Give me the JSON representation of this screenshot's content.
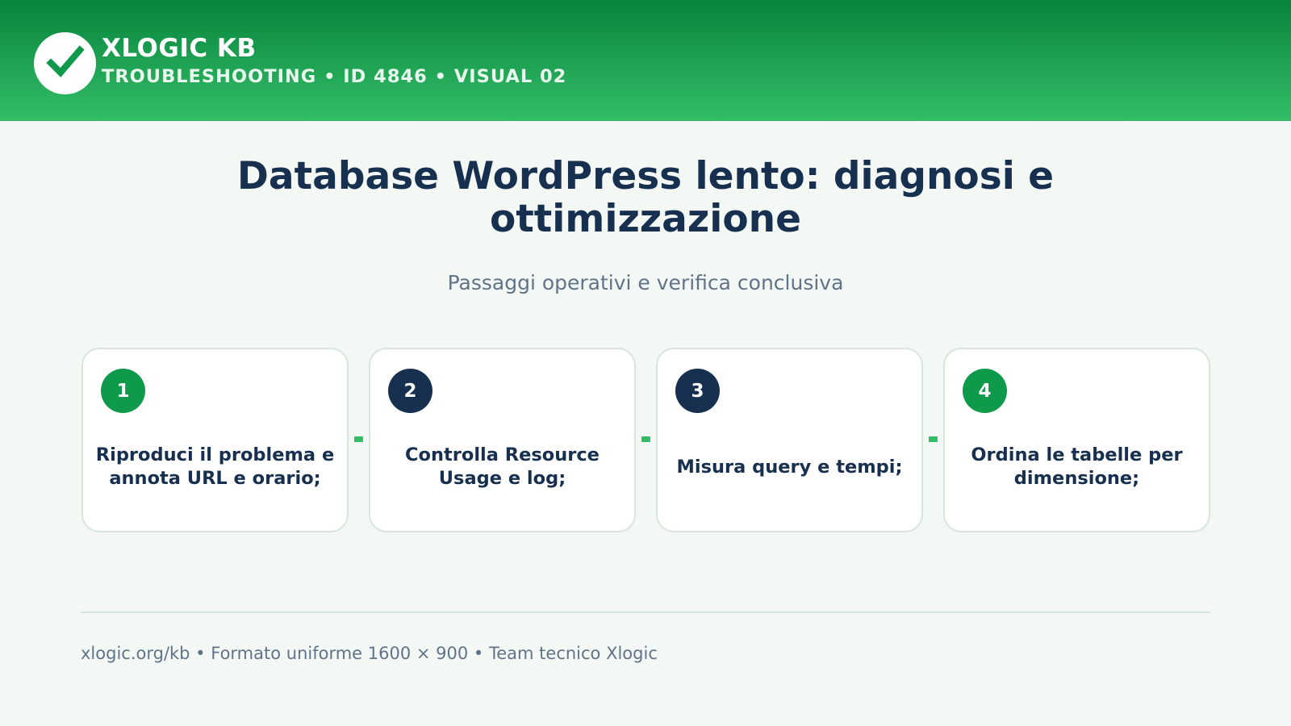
{
  "header": {
    "brand_title": "XLOGIC KB",
    "brand_subtitle": "TROUBLESHOOTING • ID 4846 • VISUAL 02",
    "logo_icon": "checkmark-icon"
  },
  "main": {
    "title": "Database WordPress lento: diagnosi e ottimizzazione",
    "subtitle": "Passaggi operativi e verifica conclusiva"
  },
  "steps": [
    {
      "number": "1",
      "text": "Riproduci il problema e annota URL e orario;",
      "badge_color": "#0e9a4a"
    },
    {
      "number": "2",
      "text": "Controlla Resource Usage e log;",
      "badge_color": "#17304f"
    },
    {
      "number": "3",
      "text": "Misura query e tempi;",
      "badge_color": "#17304f"
    },
    {
      "number": "4",
      "text": "Ordina le tabelle per dimensione;",
      "badge_color": "#0e9a4a"
    }
  ],
  "footer": {
    "text": "xlogic.org/kb • Formato uniforme 1600 × 900 • Team tecnico Xlogic"
  },
  "colors": {
    "header_top": "#06843d",
    "header_bottom": "#34bd67",
    "accent_green": "#0e9a4a",
    "navy": "#17304f",
    "connector": "#34bd67"
  }
}
